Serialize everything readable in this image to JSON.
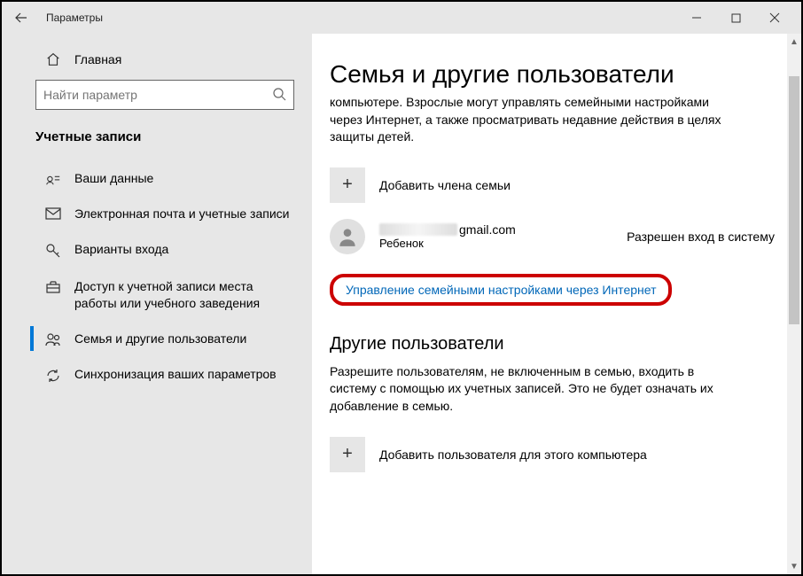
{
  "window": {
    "title": "Параметры"
  },
  "sidebar": {
    "home_label": "Главная",
    "search_placeholder": "Найти параметр",
    "section_title": "Учетные записи",
    "items": [
      {
        "label": "Ваши данные"
      },
      {
        "label": "Электронная почта и учетные записи"
      },
      {
        "label": "Варианты входа"
      },
      {
        "label": "Доступ к учетной записи места работы или учебного заведения"
      },
      {
        "label": "Семья и другие пользователи"
      },
      {
        "label": "Синхронизация ваших параметров"
      }
    ]
  },
  "content": {
    "heading": "Семья и другие пользователи",
    "intro_fragment": "компьютере. Взрослые могут управлять семейными настройками через Интернет, а также просматривать недавние действия в целях защиты детей.",
    "add_family_label": "Добавить члена семьи",
    "user": {
      "email_suffix": "gmail.com",
      "type": "Ребенок",
      "status": "Разрешен вход в систему"
    },
    "manage_link": "Управление семейными настройками через Интернет",
    "other_heading": "Другие пользователи",
    "other_desc": "Разрешите пользователям, не включенным в семью, входить в систему с помощью их учетных записей. Это не будет означать их добавление в семью.",
    "add_other_label": "Добавить пользователя для этого компьютера"
  }
}
